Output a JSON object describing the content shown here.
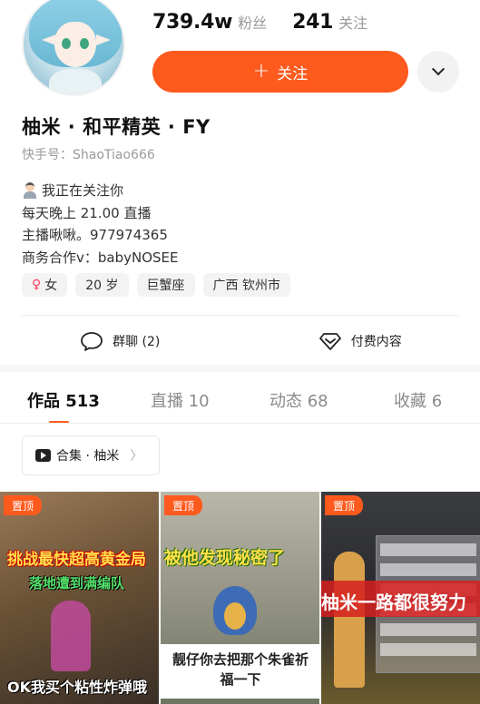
{
  "profile": {
    "followers_count": "739.4w",
    "followers_label": "粉丝",
    "following_count": "241",
    "following_label": "关注",
    "follow_button": "关注",
    "name": "柚米 · 和平精英 · FY",
    "kuaishou_id": "快手号：ShaoTiao666",
    "bio": [
      "我正在关注你",
      "每天晚上 21.00 直播",
      "主播啾啾。977974365",
      "商务合作v：babyNOSEE"
    ],
    "tags": [
      "女",
      "20 岁",
      "巨蟹座",
      "广西 钦州市"
    ]
  },
  "actions": {
    "group_chat": "群聊 (2)",
    "paid_content": "付费内容"
  },
  "tabs": [
    {
      "label": "作品 513",
      "active": true
    },
    {
      "label": "直播 10",
      "active": false
    },
    {
      "label": "动态 68",
      "active": false
    },
    {
      "label": "收藏 6",
      "active": false
    }
  ],
  "collection": {
    "label": "合集 · 柚米",
    "arrow": "〉"
  },
  "videos": [
    {
      "badge": "置顶",
      "caption_top": "挑战最快超高黄金局",
      "caption_mid": "落地遭到满编队",
      "caption_bottom": "OK我买个粘性炸弹哦"
    },
    {
      "badge": "置顶",
      "caption_top": "被他发现秘密了",
      "caption_bottom": "靓仔你去把那个朱雀祈福一下"
    },
    {
      "badge": "置顶",
      "caption_top": "柚米一路都很努力"
    }
  ],
  "colors": {
    "accent": "#fe5a1e",
    "female": "#ff3b5c"
  }
}
